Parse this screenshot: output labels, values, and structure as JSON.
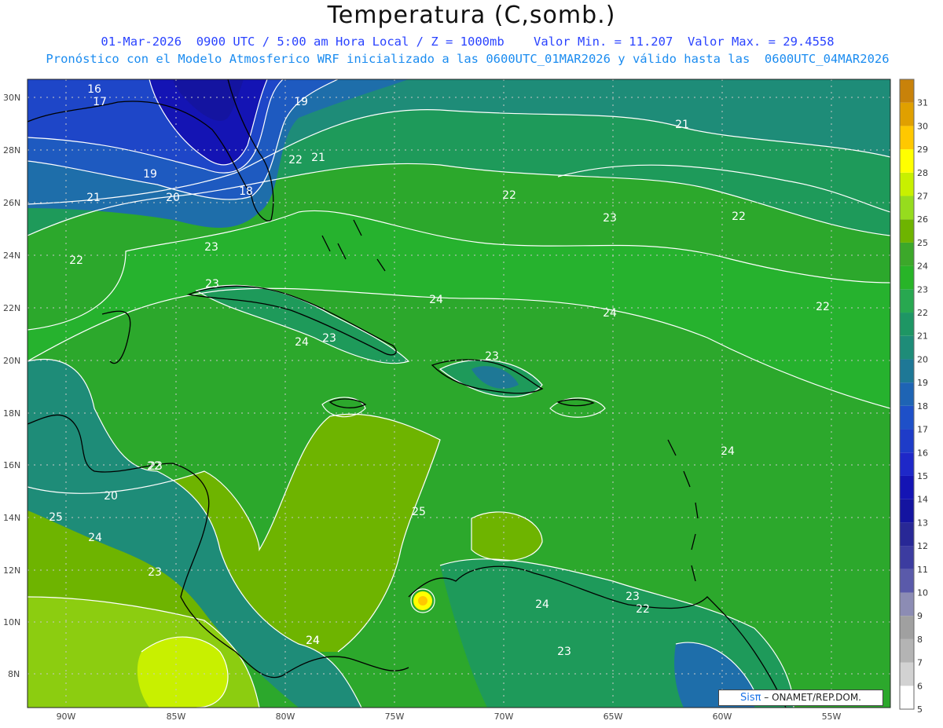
{
  "header": {
    "title": "Temperatura (C,somb.)",
    "subtitle1": "01-Mar-2026  0900 UTC / 5:00 am Hora Local / Z = 1000mb    Valor Min. = 11.207  Valor Max. = 29.4558",
    "subtitle2": "Pronóstico con el Modelo Atmosferico WRF inicializado a las 0600UTC_01MAR2026 y válido hasta las  0600UTC_04MAR2026"
  },
  "map": {
    "lat_labels": [
      "30N",
      "28N",
      "26N",
      "24N",
      "22N",
      "20N",
      "18N",
      "16N",
      "14N",
      "12N",
      "10N",
      "8N"
    ],
    "lon_labels": [
      "90W",
      "85W",
      "80W",
      "75W",
      "70W",
      "65W",
      "60W",
      "55W"
    ],
    "contour_labels": [
      "16",
      "17",
      "19",
      "21",
      "22",
      "21",
      "19",
      "18",
      "20",
      "21",
      "22",
      "22",
      "23",
      "23",
      "22",
      "22",
      "23",
      "24",
      "24",
      "24",
      "23",
      "23",
      "24",
      "23",
      "22",
      "20",
      "25",
      "24",
      "25",
      "23",
      "24",
      "24",
      "23",
      "22",
      "23",
      "24"
    ],
    "value_min": 11.207,
    "value_max": 29.4558
  },
  "colorbar": {
    "labels": [
      "31",
      "30",
      "29",
      "28",
      "27",
      "26",
      "25",
      "24",
      "23",
      "22",
      "21",
      "20",
      "19",
      "18",
      "17",
      "16",
      "15",
      "14",
      "13",
      "12",
      "11",
      "10",
      "9",
      "8",
      "7",
      "6",
      "5"
    ],
    "colors": [
      "#c8820a",
      "#e0a000",
      "#ffc800",
      "#ffff00",
      "#c8f000",
      "#96dc1e",
      "#6eb400",
      "#3ca82a",
      "#28b428",
      "#28a850",
      "#1e9664",
      "#1e8c78",
      "#1e7896",
      "#1e64b4",
      "#1e50c8",
      "#1e3cc8",
      "#1e28c8",
      "#1414b4",
      "#1414a0",
      "#282896",
      "#3c3ca0",
      "#5a5aaa",
      "#8c8cb4",
      "#a0a0a0",
      "#b4b4b4",
      "#d2d2d2",
      "#ffffff"
    ]
  },
  "credit": {
    "logo": "Sisπ",
    "text": "– ONAMET/REP.DOM."
  }
}
